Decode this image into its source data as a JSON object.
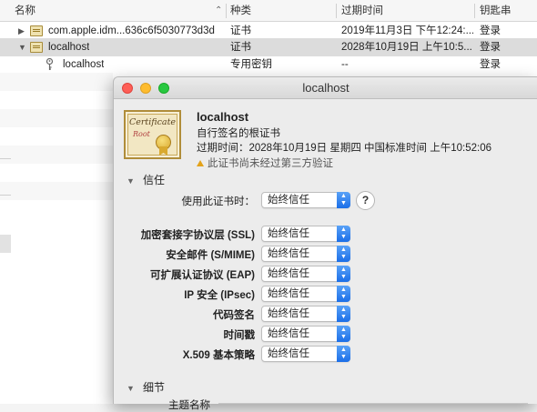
{
  "table": {
    "columns": [
      "名称",
      "种类",
      "过期时间",
      "钥匙串"
    ],
    "rows": [
      {
        "name": "com.apple.idm...636c6f5030773d3d",
        "kind": "证书",
        "expires": "2019年11月3日 下午12:24:...",
        "keychain": "登录",
        "icon": "certificate-icon",
        "disclosure": "▶"
      },
      {
        "name": "localhost",
        "kind": "证书",
        "expires": "2028年10月19日 上午10:5...",
        "keychain": "登录",
        "icon": "certificate-icon",
        "disclosure": "▼"
      },
      {
        "name": "localhost",
        "kind": "专用密钥",
        "expires": "--",
        "keychain": "登录",
        "icon": "key-icon",
        "disclosure": ""
      }
    ]
  },
  "window": {
    "title": "localhost",
    "certificate": {
      "icon_text_1": "Certificate",
      "icon_text_2": "Root",
      "name": "localhost",
      "subtitle": "自行签名的根证书",
      "expires": "过期时间：2028年10月19日 星期四 中国标准时间 上午10:52:06",
      "warning": "此证书尚未经过第三方验证"
    },
    "trust": {
      "section_title": "信任",
      "when_using_label": "使用此证书时：",
      "when_using_value": "始终信任",
      "help": "?",
      "policies": [
        {
          "label": "加密套接字协议层 (SSL)",
          "value": "始终信任"
        },
        {
          "label": "安全邮件 (S/MIME)",
          "value": "始终信任"
        },
        {
          "label": "可扩展认证协议 (EAP)",
          "value": "始终信任"
        },
        {
          "label": "IP 安全 (IPsec)",
          "value": "始终信任"
        },
        {
          "label": "代码签名",
          "value": "始终信任"
        },
        {
          "label": "时间戳",
          "value": "始终信任"
        },
        {
          "label": "X.509 基本策略",
          "value": "始终信任"
        }
      ]
    },
    "details": {
      "section_title": "细节",
      "subject_name": "主题名称"
    }
  },
  "colors": {
    "accent": "#1a6ee8",
    "close": "#fe5f57",
    "minimize": "#febc2e",
    "zoom": "#28c840",
    "warning": "#e3a21a"
  }
}
